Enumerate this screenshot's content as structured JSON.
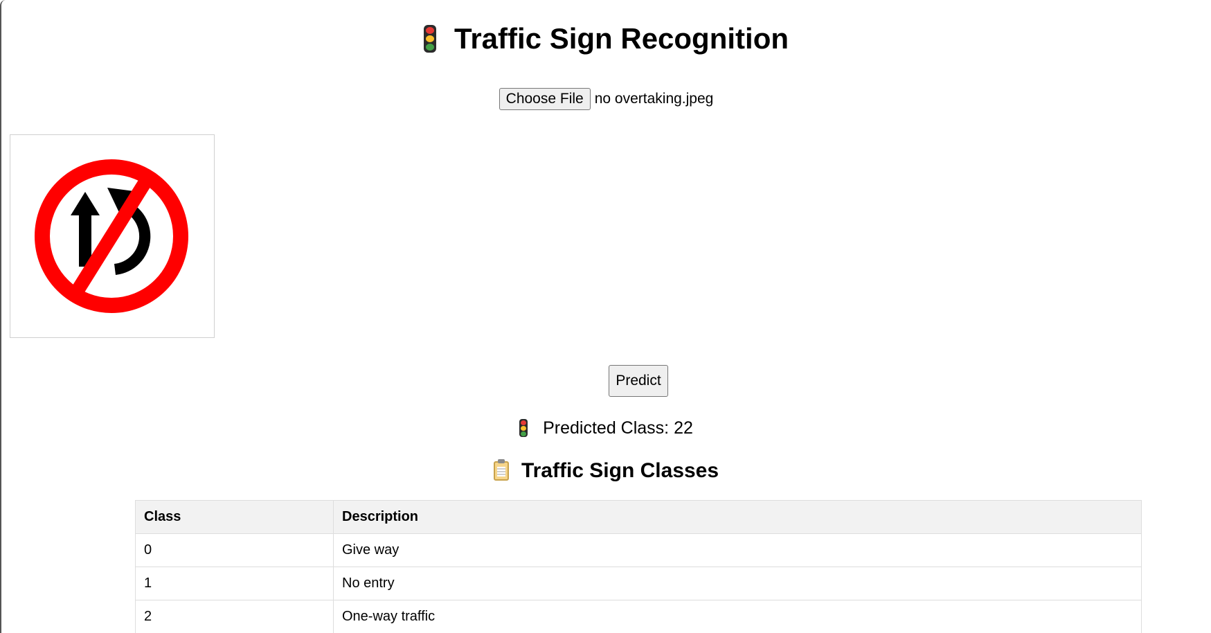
{
  "header": {
    "title": "Traffic Sign Recognition",
    "icon": "traffic-light-icon"
  },
  "upload": {
    "button_label": "Choose File",
    "file_name": "no overtaking.jpeg"
  },
  "preview": {
    "icon": "no-overtaking-sign-icon",
    "colors": {
      "ring": "#ff0000",
      "arrows": "#000000"
    }
  },
  "predict": {
    "button_label": "Predict"
  },
  "result": {
    "icon": "traffic-light-icon",
    "text": "Predicted Class: 22"
  },
  "classes": {
    "icon": "clipboard-icon",
    "title": "Traffic Sign Classes",
    "columns": [
      "Class",
      "Description"
    ],
    "rows": [
      {
        "class": "0",
        "description": "Give way"
      },
      {
        "class": "1",
        "description": "No entry"
      },
      {
        "class": "2",
        "description": "One-way traffic"
      }
    ]
  }
}
